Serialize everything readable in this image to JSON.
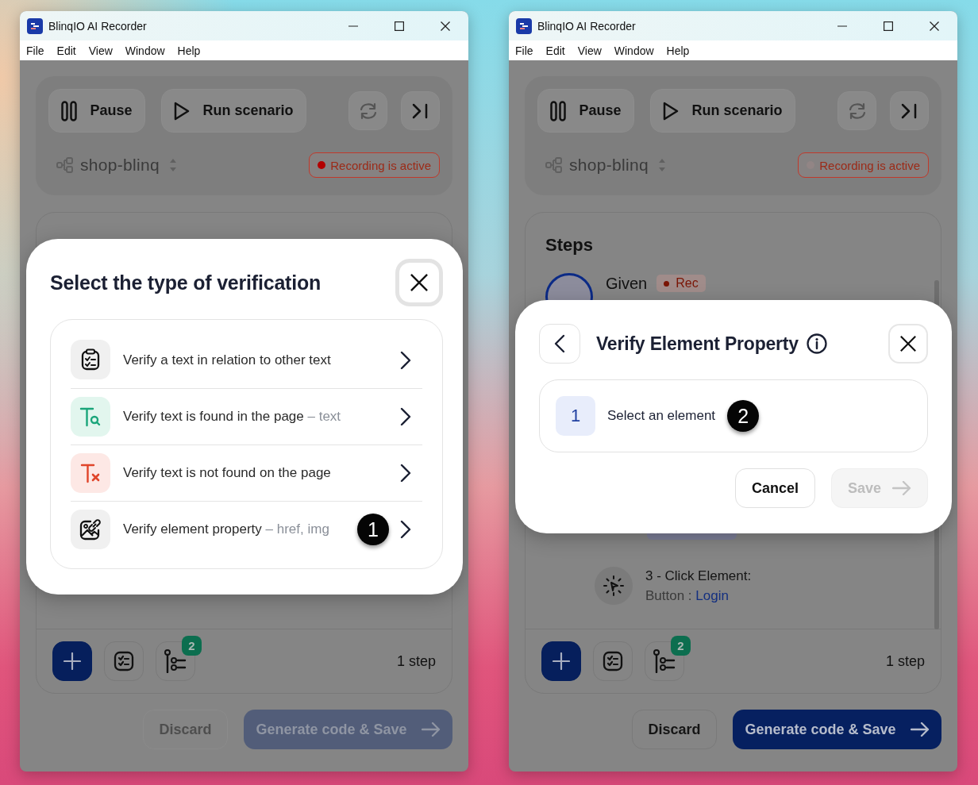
{
  "windows": [
    {
      "title": "BlinqIO AI Recorder",
      "menu": [
        "File",
        "Edit",
        "View",
        "Window",
        "Help"
      ],
      "toolbar": [
        {
          "kind": "pause",
          "label": "Pause"
        },
        {
          "kind": "run",
          "label": "Run scenario"
        },
        {
          "kind": "refresh"
        },
        {
          "kind": "skip"
        }
      ],
      "project": "shop-blinq",
      "recording": {
        "label": "Recording is active",
        "dot_on": true
      },
      "footer": {
        "badge": "2",
        "count": "1 step"
      },
      "actions": [
        {
          "kind": "discard",
          "label": "Discard",
          "disabled": true
        },
        {
          "kind": "generate",
          "label": "Generate code & Save",
          "disabled": true
        }
      ],
      "dialog": {
        "kind": "type-list",
        "title": "Select the type of verification",
        "close_focused": true,
        "options": [
          {
            "kind": "relation",
            "label": "Verify a text in relation to other text"
          },
          {
            "kind": "found",
            "label": "Verify text is found in the page",
            "hint": "– text"
          },
          {
            "kind": "not-found",
            "label": "Verify text is not found on the page"
          },
          {
            "kind": "property",
            "label": "Verify element property",
            "hint": "– href, img",
            "marker": "1"
          }
        ]
      }
    },
    {
      "title": "BlinqIO AI Recorder",
      "menu": [
        "File",
        "Edit",
        "View",
        "Window",
        "Help"
      ],
      "toolbar": [
        {
          "kind": "pause",
          "label": "Pause"
        },
        {
          "kind": "run",
          "label": "Run scenario"
        },
        {
          "kind": "refresh"
        },
        {
          "kind": "skip"
        }
      ],
      "project": "shop-blinq",
      "recording": {
        "label": "Recording is active",
        "dot_on": false
      },
      "steps": {
        "title": "Steps",
        "items": [
          {
            "kind": "given",
            "label": "Given",
            "tag": "Rec"
          },
          {
            "kind": "action",
            "title": "3 - Click Element:",
            "detail": "Button :",
            "link": "Login"
          }
        ]
      },
      "footer": {
        "badge": "2",
        "count": "1 step"
      },
      "actions": [
        {
          "kind": "discard",
          "label": "Discard",
          "disabled": false
        },
        {
          "kind": "generate",
          "label": "Generate code & Save",
          "disabled": false
        }
      ],
      "dialog": {
        "kind": "property",
        "title": "Verify Element Property",
        "close_focused": false,
        "step": {
          "number": "1",
          "label": "Select an element",
          "marker": "2"
        },
        "buttons": [
          {
            "kind": "cancel",
            "label": "Cancel",
            "disabled": false
          },
          {
            "kind": "save",
            "label": "Save",
            "disabled": true
          }
        ]
      }
    }
  ]
}
